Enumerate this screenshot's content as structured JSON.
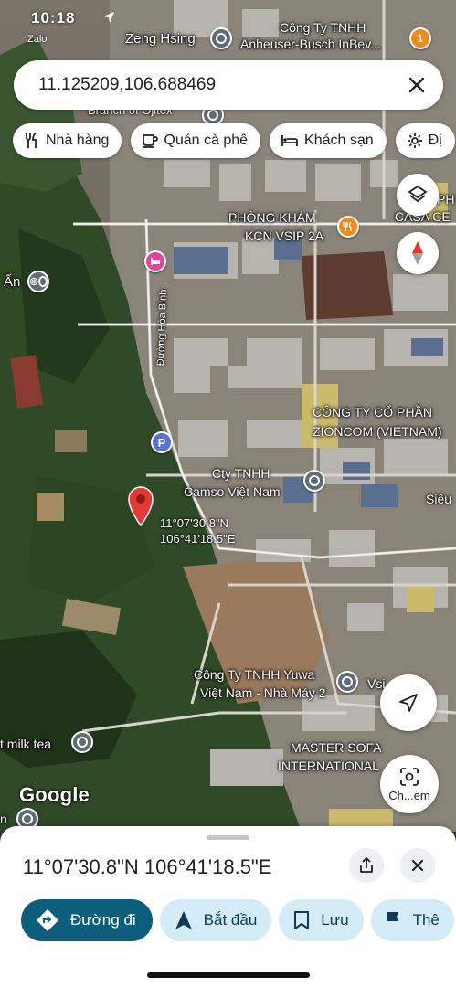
{
  "status_bar": {
    "time": "10:18",
    "app_label": "Zalo"
  },
  "search": {
    "value": "11.125209,106.688469",
    "close_icon": "close-icon"
  },
  "chips": [
    {
      "label": "Nhà hàng",
      "icon": "restaurant-icon"
    },
    {
      "label": "Quán cà phê",
      "icon": "coffee-icon"
    },
    {
      "label": "Khách sạn",
      "icon": "hotel-icon"
    },
    {
      "label": "Đị",
      "icon": "attraction-icon"
    }
  ],
  "map_labels": {
    "zeng_hsing": "Zeng Hsing",
    "anheuser_1": "Công Ty TNHH",
    "anheuser_2": "Anheuser-Busch InBev...",
    "branch_1": "Branch of Ojitex",
    "phong_kham_1": "PHÒNG KHÁM",
    "phong_kham_2": "KCN VSIP 2A",
    "casa_1": "PH",
    "casa_2": "CASA CE",
    "an": "Ấn",
    "road": "Đường Hòa Bình",
    "zioncom_1": "CÔNG TY CỔ PHẦN",
    "zioncom_2": "ZIONCOM (VIETNAM)",
    "camso_1": "Cty TNHH",
    "camso_2": "Camso Việt Nam",
    "sieu": "Siêu",
    "pin_lat": "11°07'30.8\"N",
    "pin_lng": "106°41'18.5\"E",
    "yuwa_1": "Công Ty TNHH Yuwa",
    "yuwa_2": "Việt Nam - Nhà Máy 2",
    "vsip_uy": "Vsi      Uỷ",
    "milk_tea": "t milk tea",
    "master_1": "MASTER SOFA",
    "master_2": "INTERNATIONAL",
    "n": "n",
    "parking": "P",
    "google": "Google"
  },
  "map_controls": {
    "lens_label": "Ch...em"
  },
  "sheet": {
    "title": "11°07'30.8\"N 106°41'18.5\"E",
    "actions": [
      {
        "label": "Đường đi",
        "icon": "directions-icon"
      },
      {
        "label": "Bắt đầu",
        "icon": "navigation-arrow-icon"
      },
      {
        "label": "Lưu",
        "icon": "bookmark-icon"
      },
      {
        "label": "Thê",
        "icon": "flag-icon"
      }
    ]
  },
  "colors": {
    "accent": "#0d5e7a",
    "chip_bg": "#d3ecf7",
    "pin": "#e53935"
  }
}
